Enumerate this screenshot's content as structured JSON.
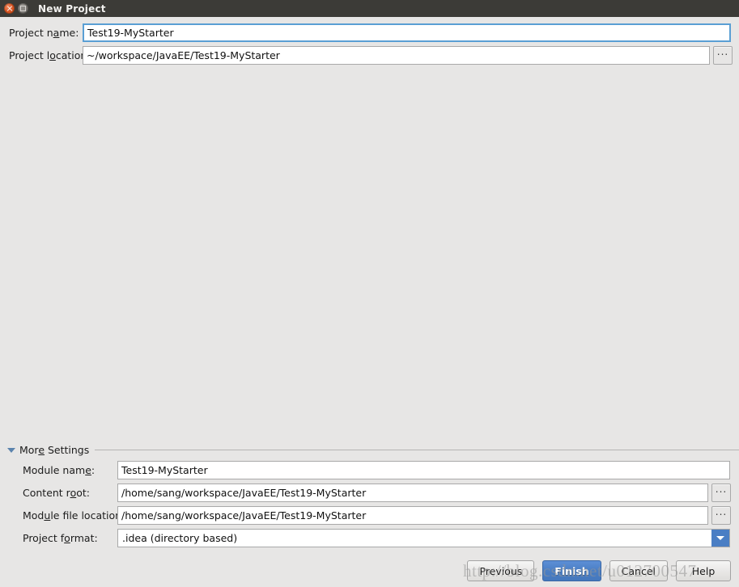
{
  "window": {
    "title": "New Project",
    "close_icon": "close-icon",
    "maximize_icon": "maximize-icon"
  },
  "top_form": {
    "project_name": {
      "label_pre": "Project n",
      "label_mnemonic": "a",
      "label_post": "me:",
      "value": "Test19-MyStarter",
      "focused": true
    },
    "project_location": {
      "label_pre": "Project l",
      "label_mnemonic": "o",
      "label_post": "cation:",
      "value": "~/workspace/JavaEE/Test19-MyStarter",
      "browse_label": "..."
    }
  },
  "more_settings": {
    "label_pre": "Mor",
    "label_mnemonic": "e",
    "label_post": " Settings",
    "expanded": true,
    "fields": {
      "module_name": {
        "label_pre": "Module nam",
        "label_mnemonic": "e",
        "label_post": ":",
        "value": "Test19-MyStarter"
      },
      "content_root": {
        "label_pre": "Content r",
        "label_mnemonic": "o",
        "label_post": "ot:",
        "value": "/home/sang/workspace/JavaEE/Test19-MyStarter",
        "browse_label": "..."
      },
      "module_file_location": {
        "label_pre": "Mod",
        "label_mnemonic": "u",
        "label_post": "le file location:",
        "value": "/home/sang/workspace/JavaEE/Test19-MyStarter",
        "browse_label": "..."
      },
      "project_format": {
        "label_pre": "Project f",
        "label_mnemonic": "o",
        "label_post": "rmat:",
        "value": ".idea (directory based)",
        "options": [
          ".idea (directory based)"
        ]
      }
    }
  },
  "footer": {
    "buttons": [
      {
        "label": "Previous",
        "primary": false
      },
      {
        "label": "Finish",
        "primary": true
      },
      {
        "label": "Cancel",
        "primary": false
      },
      {
        "label": "Help",
        "primary": false
      }
    ]
  },
  "watermark": {
    "text": "http://blog.csdn.net/u012700547"
  },
  "colors": {
    "dialog_background": "#e7e6e5",
    "titlebar_background": "#3c3b37",
    "accent_blue": "#4a7ec4",
    "focus_border": "#5a9fd4",
    "close_button": "#dd5a28"
  }
}
